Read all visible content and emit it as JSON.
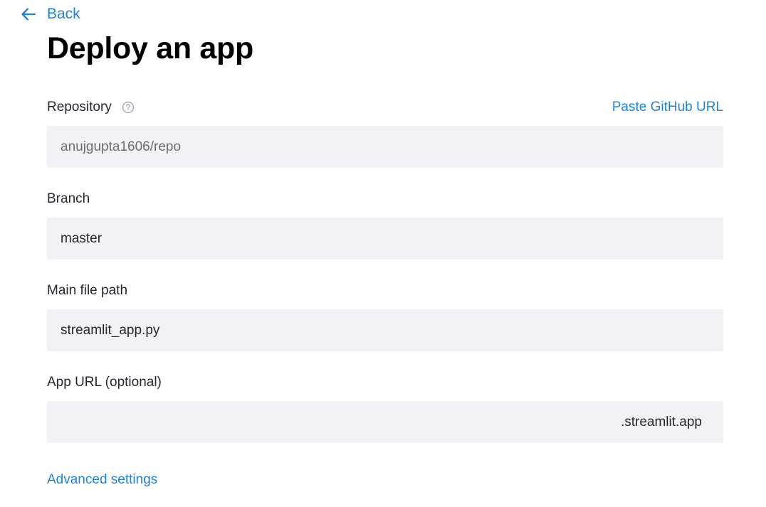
{
  "back": {
    "label": "Back",
    "icon": "arrow-left-icon"
  },
  "page_title": "Deploy an app",
  "repository": {
    "label": "Repository",
    "help_icon": "question-circle-icon",
    "paste_link": "Paste GitHub URL",
    "placeholder": "anujgupta1606/repo",
    "value": ""
  },
  "branch": {
    "label": "Branch",
    "value": "master"
  },
  "main_file": {
    "label": "Main file path",
    "value": "streamlit_app.py"
  },
  "app_url": {
    "label": "App URL (optional)",
    "value": "",
    "suffix": ".streamlit.app"
  },
  "advanced_settings": "Advanced settings",
  "colors": {
    "link": "#1c83e1",
    "input_bg": "#f0f2f6",
    "text": "#262730",
    "title": "#000000"
  }
}
